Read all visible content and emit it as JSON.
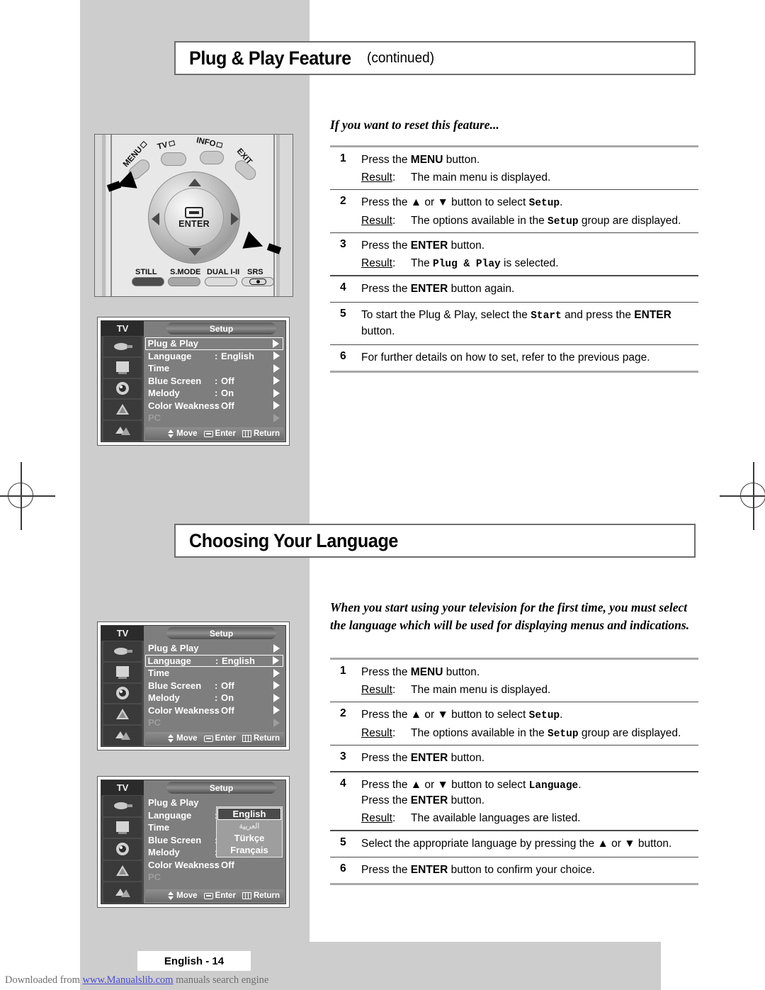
{
  "page": {
    "number_label": "English - 14",
    "footer_prefix": "Downloaded from ",
    "footer_link": "www.Manualslib.com",
    "footer_suffix": " manuals search engine"
  },
  "sections": [
    {
      "title_main": "Plug & Play Feature",
      "title_sub": "(continued)",
      "intro": "If you want to reset this feature...",
      "steps": [
        {
          "num": "1",
          "lines": [
            "Press the ",
            "MENU",
            " button."
          ],
          "result_label": "Result",
          "result_text": "The main menu is displayed."
        },
        {
          "num": "2",
          "result_label": "Result",
          "result_text": "The options available in the Setup group are displayed."
        },
        {
          "num": "3",
          "result_label": "Result",
          "result_text": "The Plug & Play is selected."
        },
        {
          "num": "4"
        },
        {
          "num": "5"
        },
        {
          "num": "6"
        }
      ],
      "step_texts": {
        "s1": "Press the MENU button.",
        "s2": "Press the ▲ or ▼ button to select Setup.",
        "s3": "Press the ENTER button.",
        "s4": "Press the ENTER button again.",
        "s5": "To start the Plug & Play, select the Start and press the ENTER button.",
        "s6": "For further details on how to set, refer to the previous page."
      }
    },
    {
      "title_main": "Choosing Your Language",
      "title_sub": "",
      "intro": "When you start using your television for the first time, you must select the language which will be used for displaying menus and indications.",
      "step_texts": {
        "s1": "Press the MENU button.",
        "s2": "Press the ▲ or ▼ button to select Setup.",
        "s3": "Press the ENTER button.",
        "s4a": "Press the ▲ or ▼ button to select Language.",
        "s4b": "Press the ENTER button.",
        "s5": "Select the appropriate language by pressing the ▲ or ▼ button.",
        "s6": "Press the ENTER button to confirm your choice."
      }
    }
  ],
  "text": {
    "press_the": "Press the ",
    "button_period": " button.",
    "button_again": " button again.",
    "or": " or ",
    "button_to_select": " button to select ",
    "period": ".",
    "result_label": "Result",
    "colon": ":",
    "menu_key": "MENU",
    "enter_key": "ENTER",
    "up_arrow": "▲",
    "down_arrow": "▼",
    "setup_token": "Setup",
    "plugplay_token": "Plug & Play",
    "language_token": "Language",
    "start_token": "Start",
    "r1_main_menu": "The main menu is displayed.",
    "r2_options_pre": "The options available in the ",
    "r2_options_post": " group are displayed.",
    "r3_pre": "The ",
    "r3_post": " is selected.",
    "r4_languages": "The available languages are listed.",
    "s4_again": "Press the ENTER button again.",
    "s5_start_pre": "To start the Plug & Play, select the ",
    "s5_start_mid": " and press the ",
    "s5_start_post": "button.",
    "s6_further": "For further details on how to set, refer to the previous page.",
    "l5_select_lang_pre": "Select the appropriate language by pressing the ",
    "l5_select_lang_post": " button.",
    "l6_confirm": "Press the ENTER button to confirm your choice.",
    "l6_confirm_pre": "Press the ",
    "l6_confirm_post": " button to confirm your choice."
  },
  "remote": {
    "labels": {
      "tv": "TV",
      "info": "INFO",
      "menu": "MENU",
      "exit": "EXIT",
      "enter": "ENTER",
      "still": "STILL",
      "smode": "S.MODE",
      "dual": "DUAL I-II",
      "srs": "SRS"
    }
  },
  "osd": {
    "tv_label": "TV",
    "setup_label": "Setup",
    "footer": {
      "move": "Move",
      "enter": "Enter",
      "return": "Return"
    },
    "rows": [
      {
        "label": "Plug & Play",
        "colon": "",
        "value": ""
      },
      {
        "label": "Language",
        "colon": ":",
        "value": "English"
      },
      {
        "label": "Time",
        "colon": "",
        "value": ""
      },
      {
        "label": "Blue Screen",
        "colon": ":",
        "value": "Off"
      },
      {
        "label": "Melody",
        "colon": ":",
        "value": "On"
      },
      {
        "label": "Color Weakness",
        "colon": ":",
        "value": "Off"
      },
      {
        "label": "PC",
        "colon": "",
        "value": ""
      }
    ],
    "language_options": [
      "English",
      "العربية",
      "Türkçe",
      "Français"
    ]
  }
}
